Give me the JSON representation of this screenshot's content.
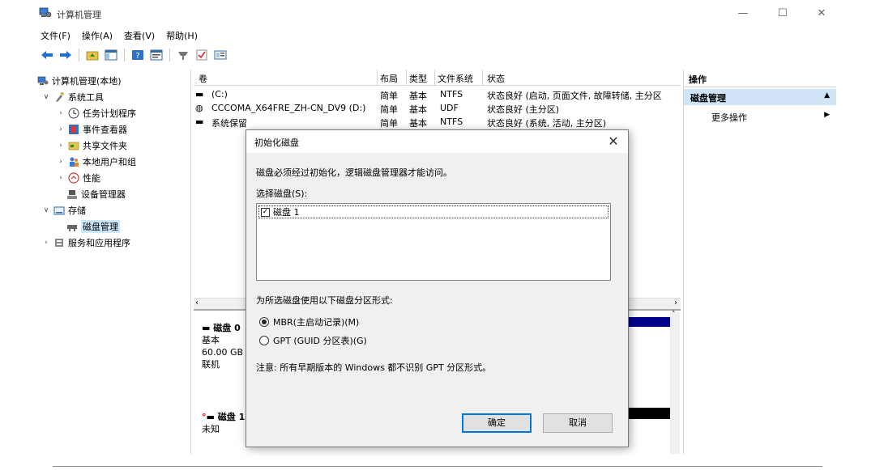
{
  "window": {
    "title": "计算机管理",
    "minimize": "—",
    "maximize": "☐",
    "close": "✕"
  },
  "menu": [
    "文件(F)",
    "操作(A)",
    "查看(V)",
    "帮助(H)"
  ],
  "tree": {
    "root": "计算机管理(本地)",
    "system_tools": "系统工具",
    "task_scheduler": "任务计划程序",
    "event_viewer": "事件查看器",
    "shared_folders": "共享文件夹",
    "local_users": "本地用户和组",
    "performance": "性能",
    "device_manager": "设备管理器",
    "storage": "存储",
    "disk_management": "磁盘管理",
    "services_apps": "服务和应用程序"
  },
  "volumes": {
    "columns": [
      "卷",
      "布局",
      "类型",
      "文件系统",
      "状态"
    ],
    "rows": [
      {
        "name": "(C:)",
        "layout": "简单",
        "type": "基本",
        "fs": "NTFS",
        "status": "状态良好 (启动, 页面文件, 故障转储, 主分区"
      },
      {
        "name": "CCCOMA_X64FRE_ZH-CN_DV9 (D:)",
        "layout": "简单",
        "type": "基本",
        "fs": "UDF",
        "status": "状态良好 (主分区)"
      },
      {
        "name": "系统保留",
        "layout": "简单",
        "type": "基本",
        "fs": "NTFS",
        "status": "状态良好 (系统, 活动, 主分区)"
      }
    ]
  },
  "disks": [
    {
      "title": "磁盘 0",
      "type": "基本",
      "size": "60.00 GB",
      "state": "联机"
    },
    {
      "title": "磁盘 1",
      "type": "未知",
      "size": "",
      "state": ""
    }
  ],
  "actions": {
    "header": "操作",
    "section": "磁盘管理",
    "more": "更多操作"
  },
  "dialog": {
    "title": "初始化磁盘",
    "intro": "磁盘必须经过初始化，逻辑磁盘管理器才能访问。",
    "select_label": "选择磁盘(S):",
    "disk_item": "磁盘 1",
    "disk_checked": true,
    "style_label": "为所选磁盘使用以下磁盘分区形式:",
    "mbr": "MBR(主启动记录)(M)",
    "gpt": "GPT (GUID 分区表)(G)",
    "selected_style": "MBR",
    "note": "注意: 所有早期版本的 Windows 都不识别 GPT 分区形式。",
    "ok": "确定",
    "cancel": "取消"
  }
}
